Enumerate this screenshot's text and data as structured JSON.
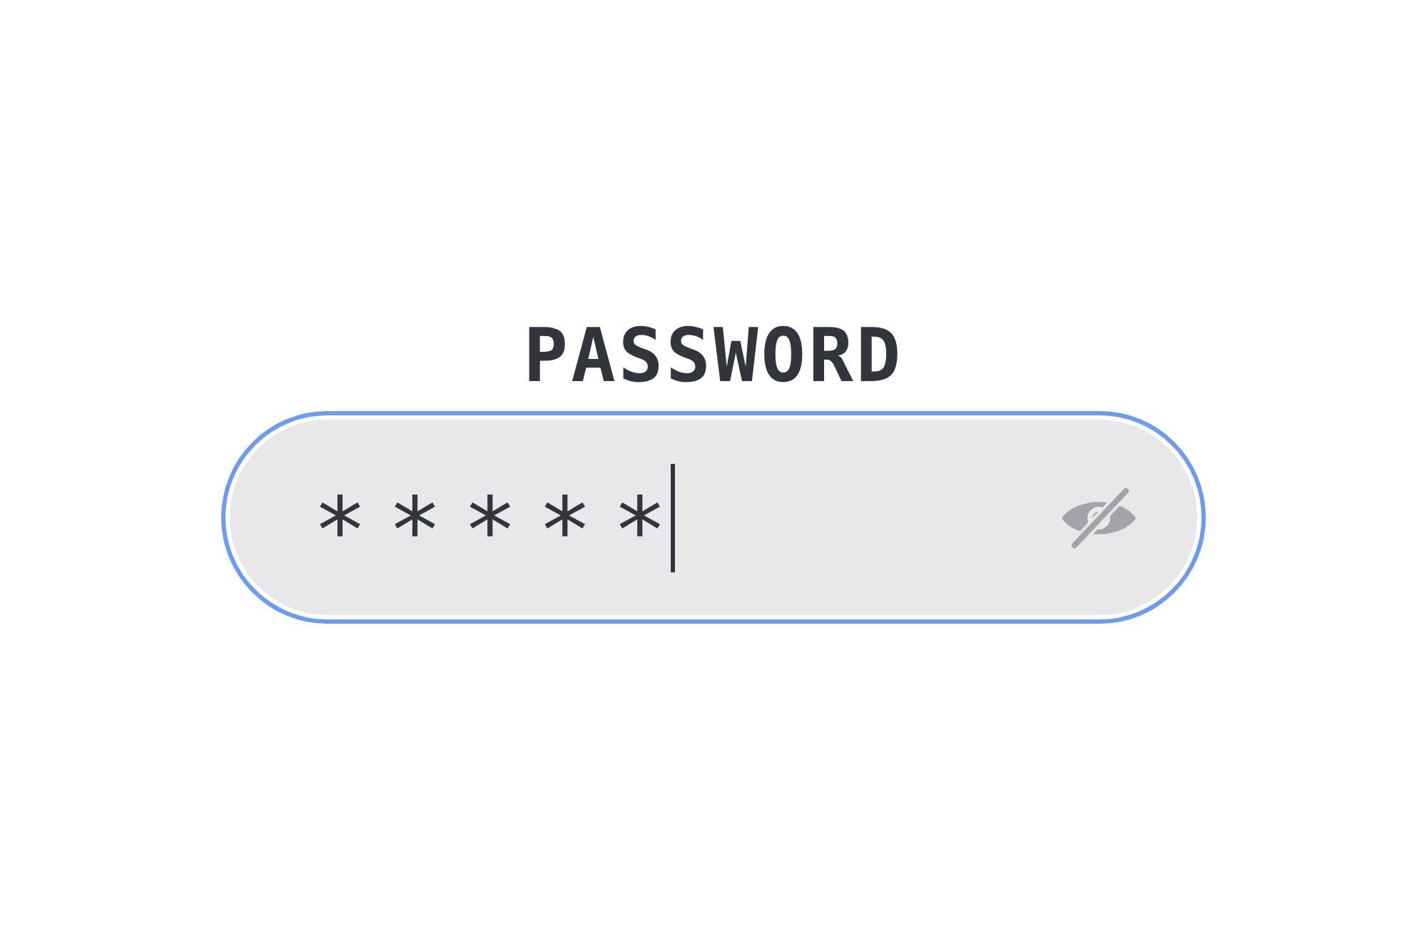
{
  "label": "PASSWORD",
  "field": {
    "value": "*****",
    "focused": true,
    "masked": true
  }
}
